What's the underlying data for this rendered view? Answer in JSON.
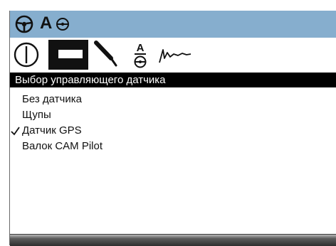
{
  "title_bar": {
    "steering_icon": "steering-wheel-icon",
    "mode_letter": "A",
    "mode_icon": "auto-steering-icon",
    "background": "#86aece"
  },
  "tabs": [
    {
      "icon": "power-icon"
    },
    {
      "icon": "display-settings-icon",
      "selected": true
    },
    {
      "icon": "probe-icon"
    },
    {
      "icon": "sensor-height-icon",
      "letter": "A"
    },
    {
      "icon": "signal-wave-icon"
    }
  ],
  "panel": {
    "title": "Выбор управляющего датчика",
    "options": [
      {
        "label": "Без датчика",
        "checked": false
      },
      {
        "label": "Щупы",
        "checked": false
      },
      {
        "label": "Датчик GPS",
        "checked": true
      },
      {
        "label": "Валок CAM Pilot",
        "checked": false
      }
    ]
  }
}
